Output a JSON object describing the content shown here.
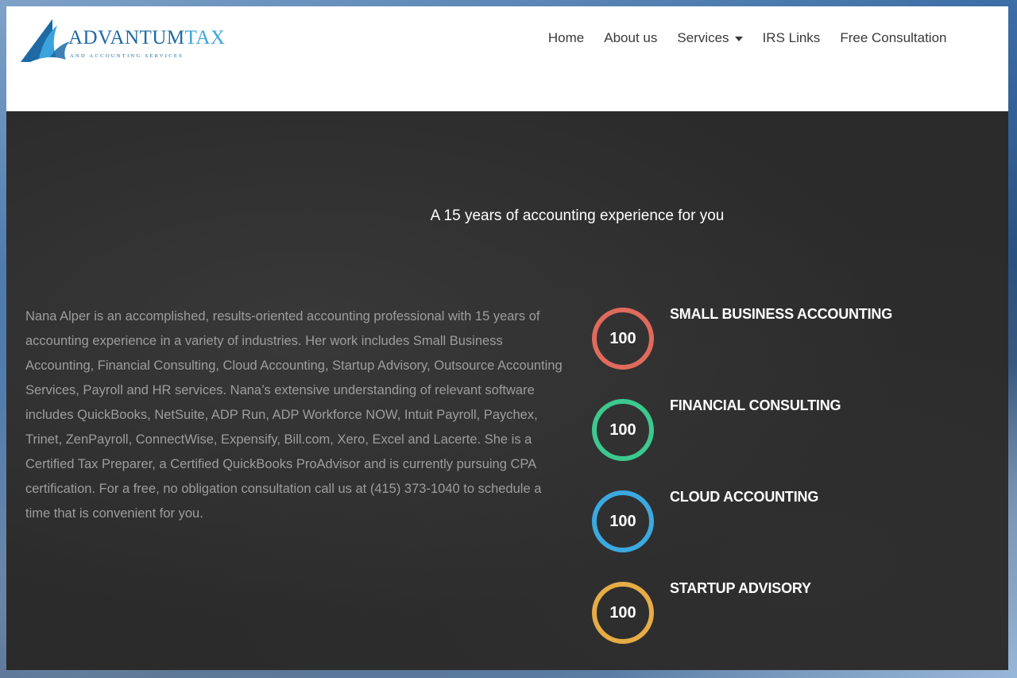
{
  "brand": {
    "name_main": "ADVANTUM",
    "name_accent": "TAX",
    "tagline": "AND ACCOUNTING SERVICES",
    "logo_icon": "sail-logo-icon",
    "colors": {
      "primary": "#1d6aa5",
      "accent": "#3aa3dc"
    }
  },
  "nav": {
    "items": [
      {
        "label": "Home"
      },
      {
        "label": "About us"
      },
      {
        "label": "Services",
        "has_dropdown": true
      },
      {
        "label": "IRS Links"
      },
      {
        "label": "Free Consultation"
      }
    ]
  },
  "main": {
    "headline": "A 15 years of accounting experience for you",
    "bio": "Nana Alper is an accomplished, results-oriented accounting professional with 15 years of accounting experience in a variety of industries. Her work includes Small Business Accounting, Financial Consulting, Cloud Accounting, Startup Advisory, Outsource Accounting Services, Payroll and HR services. Nana’s extensive understanding of relevant software includes QuickBooks, NetSuite, ADP Run, ADP Workforce NOW, Intuit Payroll, Paychex, Trinet, ZenPayroll, ConnectWise, Expensify, Bill.com, Xero, Excel and Lacerte. She is a Certified Tax Preparer, a Certified QuickBooks ProAdvisor and is currently pursuing CPA certification. For a free, no obligation consultation call us at (415) 373-1040 to schedule a time that is convenient for you."
  },
  "skills": [
    {
      "title": "SMALL BUSINESS ACCOUNTING",
      "value": "100",
      "color": "#e06a5c"
    },
    {
      "title": "FINANCIAL CONSULTING",
      "value": "100",
      "color": "#3cc98f"
    },
    {
      "title": "CLOUD ACCOUNTING",
      "value": "100",
      "color": "#3ba9df"
    },
    {
      "title": "STARTUP ADVISORY",
      "value": "100",
      "color": "#e6ac45"
    }
  ]
}
